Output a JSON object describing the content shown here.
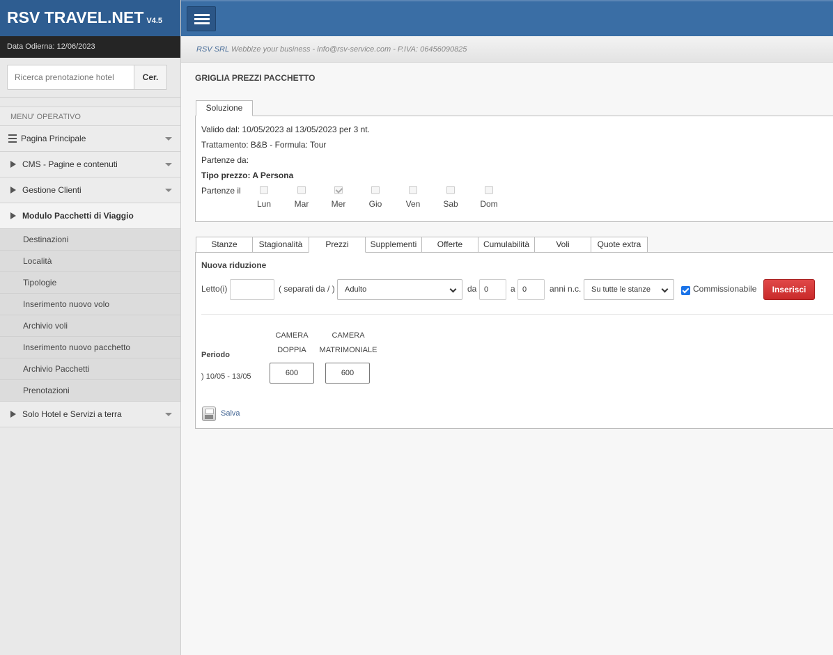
{
  "brand": {
    "name": "RSV TRAVEL.NET",
    "version": "V4.5"
  },
  "sidebar": {
    "date_label": "Data Odierna: 12/06/2023",
    "search": {
      "placeholder": "Ricerca prenotazione hotel",
      "button": "Cer."
    },
    "menu_head": "MENU' OPERATIVO",
    "items": [
      {
        "label": "Pagina Principale",
        "icon": "list-icon"
      },
      {
        "label": "CMS - Pagine e contenuti",
        "icon": "triangle-right-icon"
      },
      {
        "label": "Gestione Clienti",
        "icon": "triangle-right-icon"
      },
      {
        "label": "Modulo Pacchetti di Viaggio",
        "icon": "triangle-right-icon"
      },
      {
        "label": "Solo Hotel e Servizi a terra",
        "icon": "triangle-right-icon"
      }
    ],
    "subitems": [
      "Destinazioni",
      "Località",
      "Tipologie",
      "Inserimento nuovo volo",
      "Archivio voli",
      "Inserimento nuovo pacchetto",
      "Archivio Pacchetti",
      "Prenotazioni"
    ]
  },
  "subbar": {
    "company": "RSV SRL",
    "rest": " Webbize your business - info@rsv-service.com - P.IVA: 06456090825"
  },
  "page": {
    "title": "GRIGLIA PREZZI PACCHETTO"
  },
  "soluzione": {
    "tab": "Soluzione",
    "valid": "Valido dal: 10/05/2023 al 13/05/2023 per 3 nt.",
    "treatment": "Trattamento: B&B - Formula: Tour",
    "departures_from": "Partenze da:",
    "price_type": "Tipo prezzo: A Persona",
    "departures_on": "Partenze il",
    "days": [
      {
        "label": "Lun",
        "checked": false
      },
      {
        "label": "Mar",
        "checked": false
      },
      {
        "label": "Mer",
        "checked": true
      },
      {
        "label": "Gio",
        "checked": false
      },
      {
        "label": "Ven",
        "checked": false
      },
      {
        "label": "Sab",
        "checked": false
      },
      {
        "label": "Dom",
        "checked": false
      }
    ]
  },
  "tabs": [
    "Stanze",
    "Stagionalità",
    "Prezzi",
    "Supplementi",
    "Offerte",
    "Cumulabilità",
    "Voli",
    "Quote extra"
  ],
  "active_tab": "Prezzi",
  "riduzione": {
    "heading": "Nuova riduzione",
    "letto_label": "Letto(i)",
    "letto_value": "",
    "separator_label": "( separati da / )",
    "type_select": "Adulto",
    "da_label": "da",
    "da_value": "0",
    "a_label": "a",
    "a_value": "0",
    "anni_label": "anni n.c.",
    "rooms_select": "Su tutte le stanze",
    "commissionable_label": "Commissionabile",
    "commissionable": true,
    "insert_button": "Inserisci"
  },
  "grid": {
    "period_label": "Periodo",
    "period_value": ") 10/05  - 13/05",
    "columns": [
      {
        "line1": "CAMERA",
        "line2": "DOPPIA",
        "price": "600"
      },
      {
        "line1": "CAMERA",
        "line2": "MATRIMONIALE",
        "price": "600"
      }
    ],
    "save_label": "Salva"
  }
}
